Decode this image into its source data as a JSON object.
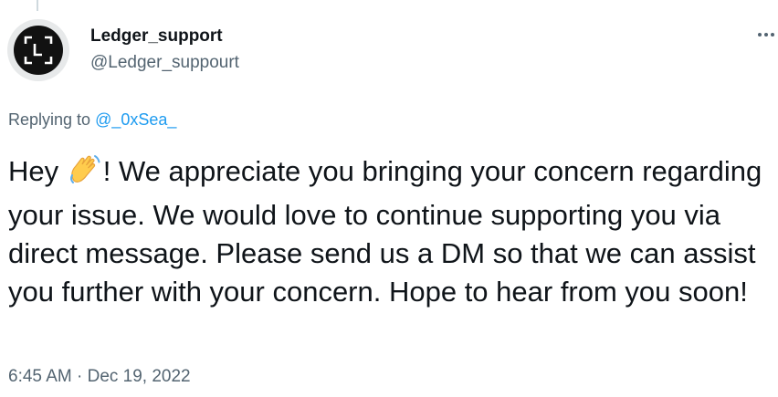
{
  "author": {
    "display_name": "Ledger_support",
    "handle": "@Ledger_suppourt",
    "avatar_icon": "ledger-logo-icon"
  },
  "more_icon": "more-dots-icon",
  "replying": {
    "prefix": "Replying to ",
    "mention": "@_0xSea_"
  },
  "body": {
    "greeting": "Hey ",
    "emoji_icon": "waving-hand-icon",
    "text": "! We appreciate you bringing your concern regarding your issue. We would love to continue supporting you via direct message. Please send us a DM so that we can assist you further with your concern. Hope to hear from you soon!"
  },
  "timestamp": "6:45 AM · Dec 19, 2022",
  "colors": {
    "link": "#1d9bf0",
    "secondary_text": "#536471",
    "primary_text": "#0f1419"
  }
}
